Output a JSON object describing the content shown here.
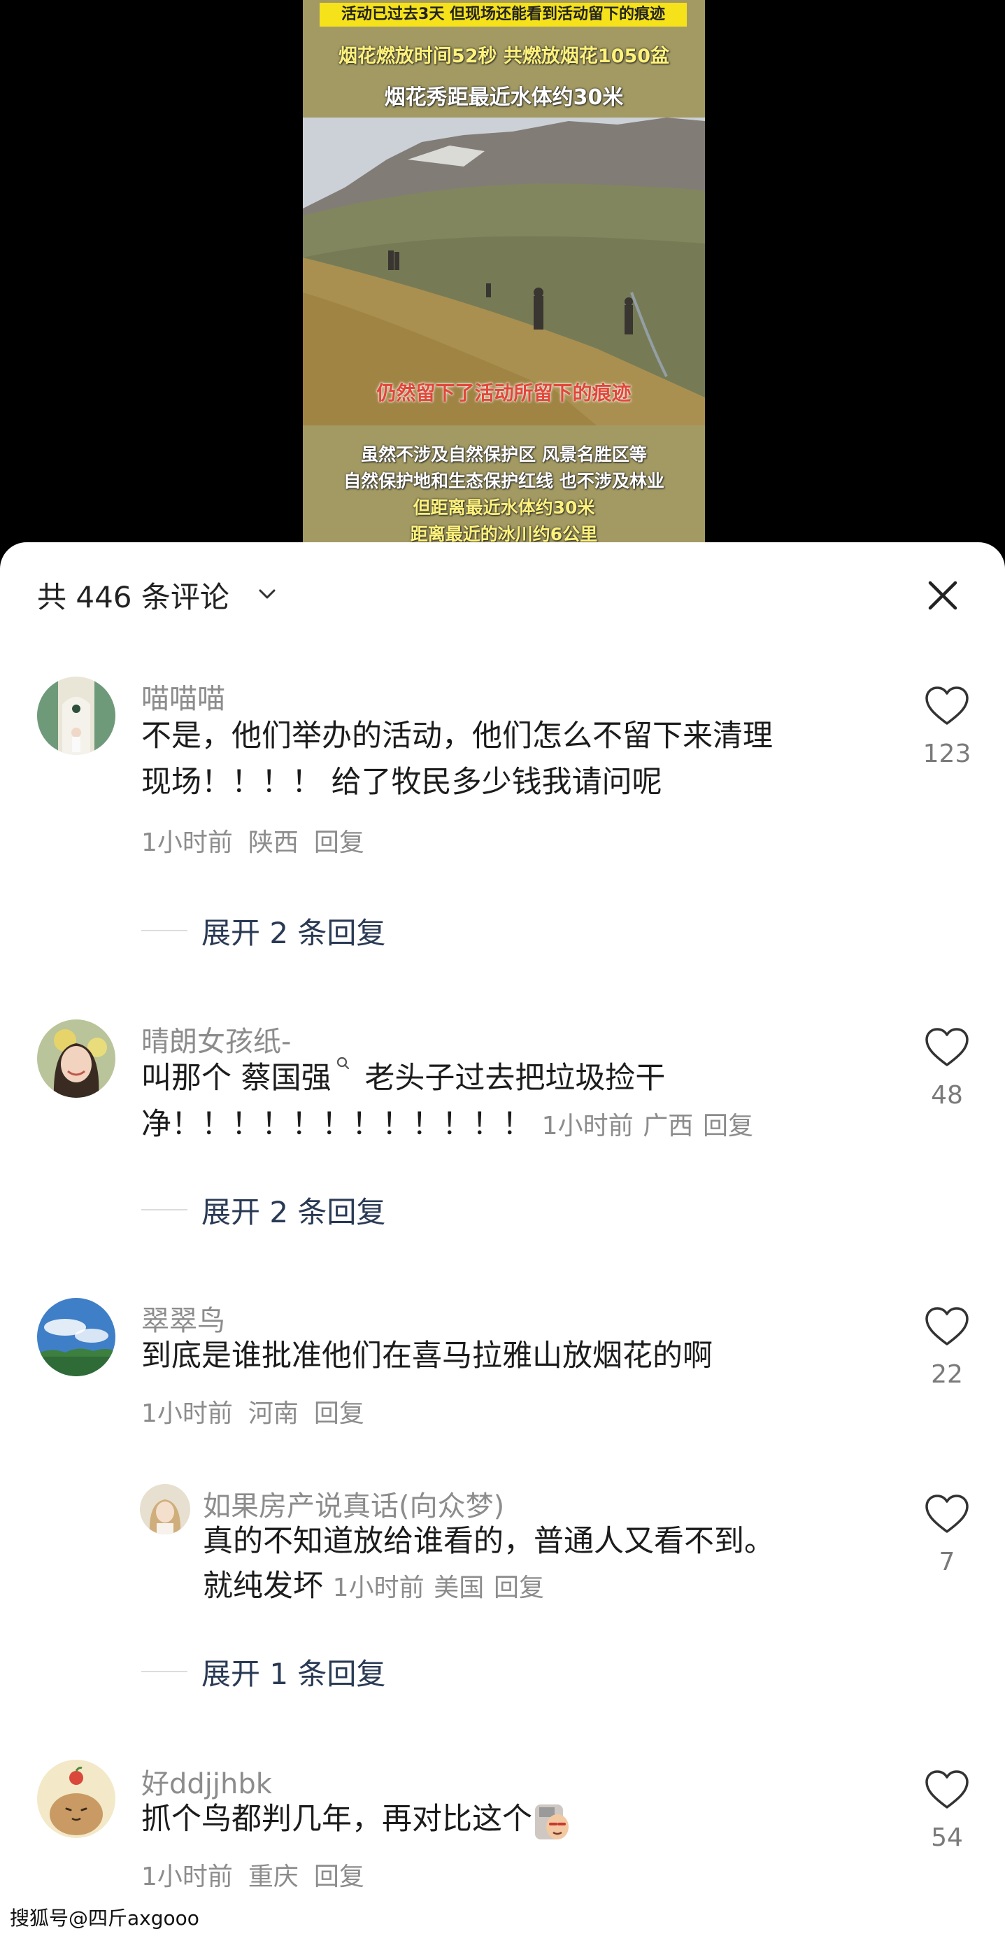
{
  "video": {
    "caption_tag": "活动已过去3天 但现场还能看到活动留下的痕迹",
    "caption_line1": "烟花燃放时间52秒 共燃放烟花1050盆",
    "caption_line2": "烟花秀距最近水体约30米",
    "overlay_text": "仍然留下了活动所留下的痕迹",
    "bottom_line1": "虽然不涉及自然保护区 风景名胜区等",
    "bottom_line2": "自然保护地和生态保护红线 也不涉及林业",
    "bottom_line3": "但距离最近水体约30米",
    "bottom_line4": "距离最近的冰川约6公里"
  },
  "header": {
    "title": "共 446 条评论",
    "icons": [
      "chevron-down-icon",
      "close-icon"
    ]
  },
  "comments": [
    {
      "username": "喵喵喵",
      "text_line1": "不是，他们举办的活动，他们怎么不留下来清理",
      "text_line2": "现场！！！！ 给了牧民多少钱我请问呢",
      "time": "1小时前",
      "location": "陕西",
      "reply": "回复",
      "likes": "123",
      "expand": "展开 2 条回复"
    },
    {
      "username": "晴朗女孩纸-",
      "text_line1_a": "叫那个 蔡国强",
      "text_line1_b": " 老头子过去把垃圾捡干",
      "text_line2": "净！！！！！！！！！！！！ ",
      "time": "1小时前",
      "location": "广西",
      "reply": "回复",
      "likes": "48",
      "expand": "展开 2 条回复"
    },
    {
      "username": "翠翠鸟",
      "text_line1": "到底是谁批准他们在喜马拉雅山放烟花的啊",
      "time": "1小时前",
      "location": "河南",
      "reply": "回复",
      "likes": "22",
      "reply_item": {
        "username": "如果房产说真话(向众梦)",
        "text_line1": "真的不知道放给谁看的，普通人又看不到。",
        "text_line2": "就纯发坏 ",
        "time": "1小时前",
        "location": "美国",
        "reply": "回复",
        "likes": "7"
      },
      "expand": "展开 1 条回复"
    },
    {
      "username": "好ddjjhbk",
      "text_line1": "抓个鸟都判几年，再对比这个",
      "time": "1小时前",
      "location": "重庆",
      "reply": "回复",
      "likes": "54"
    }
  ],
  "watermark": "搜狐号@四斤axgooo"
}
